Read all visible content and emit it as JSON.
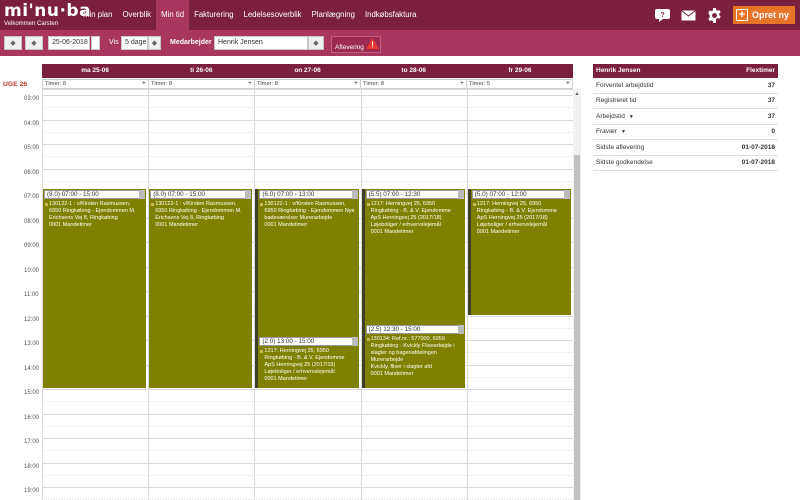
{
  "app": {
    "logo": "mi'nu·ba",
    "welcome": "Velkommen Carsten"
  },
  "nav": {
    "items": [
      {
        "label": "Min plan"
      },
      {
        "label": "Overblik"
      },
      {
        "label": "Min tid"
      },
      {
        "label": "Fakturering"
      },
      {
        "label": "Ledelsesoverblik"
      },
      {
        "label": "Planlægning"
      },
      {
        "label": "Indkøbsfaktura"
      }
    ],
    "active": "Min tid",
    "create_label": "Opret ny"
  },
  "toolbar": {
    "date": "25-06-2018",
    "vis_label": "Vis",
    "days": "5 dage",
    "employee_label": "Medarbejder",
    "employee": "Henrik Jensen",
    "aflevering": "Aflevering"
  },
  "calendar": {
    "week": "UGE 26",
    "days": [
      "ma 25-06",
      "ti 26-06",
      "on 27-06",
      "to 28-06",
      "fr 29-06"
    ],
    "timer": [
      "Timer: 8",
      "Timer: 8",
      "Timer: 8",
      "Timer: 8",
      "Timer: 5"
    ],
    "hours": [
      "03:00",
      "04:00",
      "05:00",
      "06:00",
      "07:00",
      "08:00",
      "09:00",
      "10:00",
      "11:00",
      "12:00",
      "13:00",
      "14:00",
      "15:00",
      "16:00",
      "17:00",
      "18:00",
      "19:00"
    ],
    "events": [
      {
        "day": 0,
        "header": "(8.0) 07:00 - 15:00",
        "lines": [
          "130122-1 : v/Kirsten Rasmussen,",
          "6950 Ringkøbing - Ejendommen M.",
          "Erichsens Vej 8, Ringkøbing",
          "0001 Mandetimer"
        ]
      },
      {
        "day": 1,
        "header": "(8.0) 07:00 - 15:00",
        "lines": [
          "130122-1 : v/Kirsten Rasmussen,",
          "6950 Ringkøbing - Ejendommen M.",
          "Erichsens Vej 8, Ringkøbing",
          "0001 Mandetimer"
        ]
      },
      {
        "day": 2,
        "header": "(6.0) 07:00 - 13:00",
        "lines": [
          "130122-1 : v/Kirsten Rasmussen,",
          "6950 Ringkøbing - Ejendommen Nye",
          "badeværelser Murerarbejde",
          "0001 Mandetimer"
        ]
      },
      {
        "day": 2,
        "header": "(2.0) 13:00 - 15:00",
        "lines": [
          "1217: Herningvej 25, 6950",
          "Ringkøbing - B. & V. Ejendomme",
          "ApS Herningvej 25 (2017/18)",
          "Løjeboliger / erhvervslejemål",
          "0001 Mandetimer"
        ]
      },
      {
        "day": 3,
        "header": "(5.5) 07:00 - 12:30",
        "lines": [
          "1217: Herningvej 25, 6950",
          "Ringkøbing - B. & V. Ejendomme",
          "ApS Herningvej 25 (2017/18)",
          "Løjeboliger / erhvervslejemål",
          "0001 Mandetimer"
        ]
      },
      {
        "day": 3,
        "header": "(2.5) 12:30 - 15:00",
        "lines": [
          "130134: Ref.nr.: 577000, 6950",
          "Ringkøbing - Kvickly Flisearbejde i",
          "slagter og bageriafdelingen",
          "Murerarbejde",
          "Kvickly, fliser i slagter afd",
          "0001 Mandetimer"
        ]
      },
      {
        "day": 4,
        "header": "(5.0) 07:00 - 12:00",
        "lines": [
          "1217: Herningvej 25, 6950",
          "Ringkøbing - B. & V. Ejendomme",
          "ApS Herningvej 25 (2017/18)",
          "Løjeboliger / erhvervslejemål",
          "0001 Mandetimer"
        ]
      }
    ]
  },
  "summary": {
    "name": "Henrik Jensen",
    "header_right": "Flextimer",
    "rows": [
      {
        "label": "Forventet arbejdstid",
        "value": "37"
      },
      {
        "label": "Registreret tid",
        "value": "37"
      },
      {
        "label": "Arbejdstid",
        "value": "37"
      },
      {
        "label": "Fravær",
        "value": "0"
      },
      {
        "label": "Sidste aflevering",
        "value": "01-07-2018"
      },
      {
        "label": "Sidste godkendelse",
        "value": "01-07-2018"
      }
    ]
  },
  "colors": {
    "brand": "#7a1f3d",
    "toolbar": "#a8365e",
    "event": "#808000",
    "accent": "#e8742a"
  }
}
